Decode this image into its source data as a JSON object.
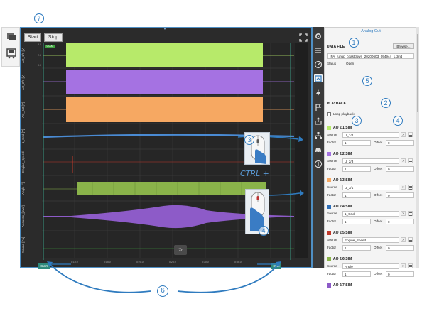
{
  "toolbar": {
    "start_label": "Start",
    "stop_label": "Stop"
  },
  "plot": {
    "start_marker": "Start",
    "stop_marker": "Stop",
    "badge": "0.000",
    "ff_label": "»",
    "channels": [
      {
        "label": "AO_1/1 [V]",
        "color": "#b7ea6a"
      },
      {
        "label": "AO_2/1 [V]",
        "color": "#a572e2"
      },
      {
        "label": "AO_2/3 [V]",
        "color": "#f6a862"
      },
      {
        "label": "1_Grid [V]",
        "color": "#4a8bd4"
      },
      {
        "label": "Engine_Speed",
        "color": "#c0392b"
      },
      {
        "label": "Angle [°]",
        "color": "#8ab34a"
      },
      {
        "label": "Acoustic_[m/s²]",
        "color": "#8d5bc8"
      },
      {
        "label": "Sound [Pa]",
        "color": "#3fa33f"
      }
    ],
    "x_ticks": [
      "0:10.0",
      "0:15.0",
      "0:20.0",
      "0:25.0",
      "0:30.0",
      "0:35.0"
    ],
    "y_ticks_top": [
      "5.0",
      "2.5",
      "0.0"
    ]
  },
  "panel": {
    "title": "Analog Out",
    "data_file_heading": "DATA FILE",
    "browse_label": "Browse...",
    "file_name": "_PA_runup_coastdown_20200603_094944_1.dmd",
    "status_label": "Status",
    "status_value": "Open",
    "playback_heading": "PLAYBACK",
    "loop_label": "Loop playback",
    "source_label": "Source",
    "factor_label": "Factor",
    "offset_label": "Offset",
    "clear_label": "X",
    "outputs": [
      {
        "name": "AO 2/1 SIM",
        "color": "#b7ea6a",
        "source": "U_1/2",
        "factor": "1",
        "offset": "0"
      },
      {
        "name": "AO 2/2 SIM",
        "color": "#a572e2",
        "source": "U_2/3",
        "factor": "1",
        "offset": "0"
      },
      {
        "name": "AO 2/3 SIM",
        "color": "#f6a862",
        "source": "U_3/1",
        "factor": "1",
        "offset": "0"
      },
      {
        "name": "AO 2/4 SIM",
        "color": "#2f6fb8",
        "source": "1_Grid",
        "factor": "1",
        "offset": "0"
      },
      {
        "name": "AO 2/5 SIM",
        "color": "#c0392b",
        "source": "Engine_Speed",
        "factor": "1",
        "offset": "0"
      },
      {
        "name": "AO 2/6 SIM",
        "color": "#8ab34a",
        "source": "Angle",
        "factor": "1",
        "offset": "0"
      },
      {
        "name": "AO 2/7 SIM",
        "color": "#8d5bc8"
      }
    ]
  },
  "callouts": {
    "n1": "1",
    "n2": "2",
    "n3": "3",
    "n4": "4",
    "n5": "5",
    "n6": "6",
    "n7": "7",
    "ctrl": "CTRL +",
    "mouse_a": "3",
    "mouse_b": "4"
  }
}
